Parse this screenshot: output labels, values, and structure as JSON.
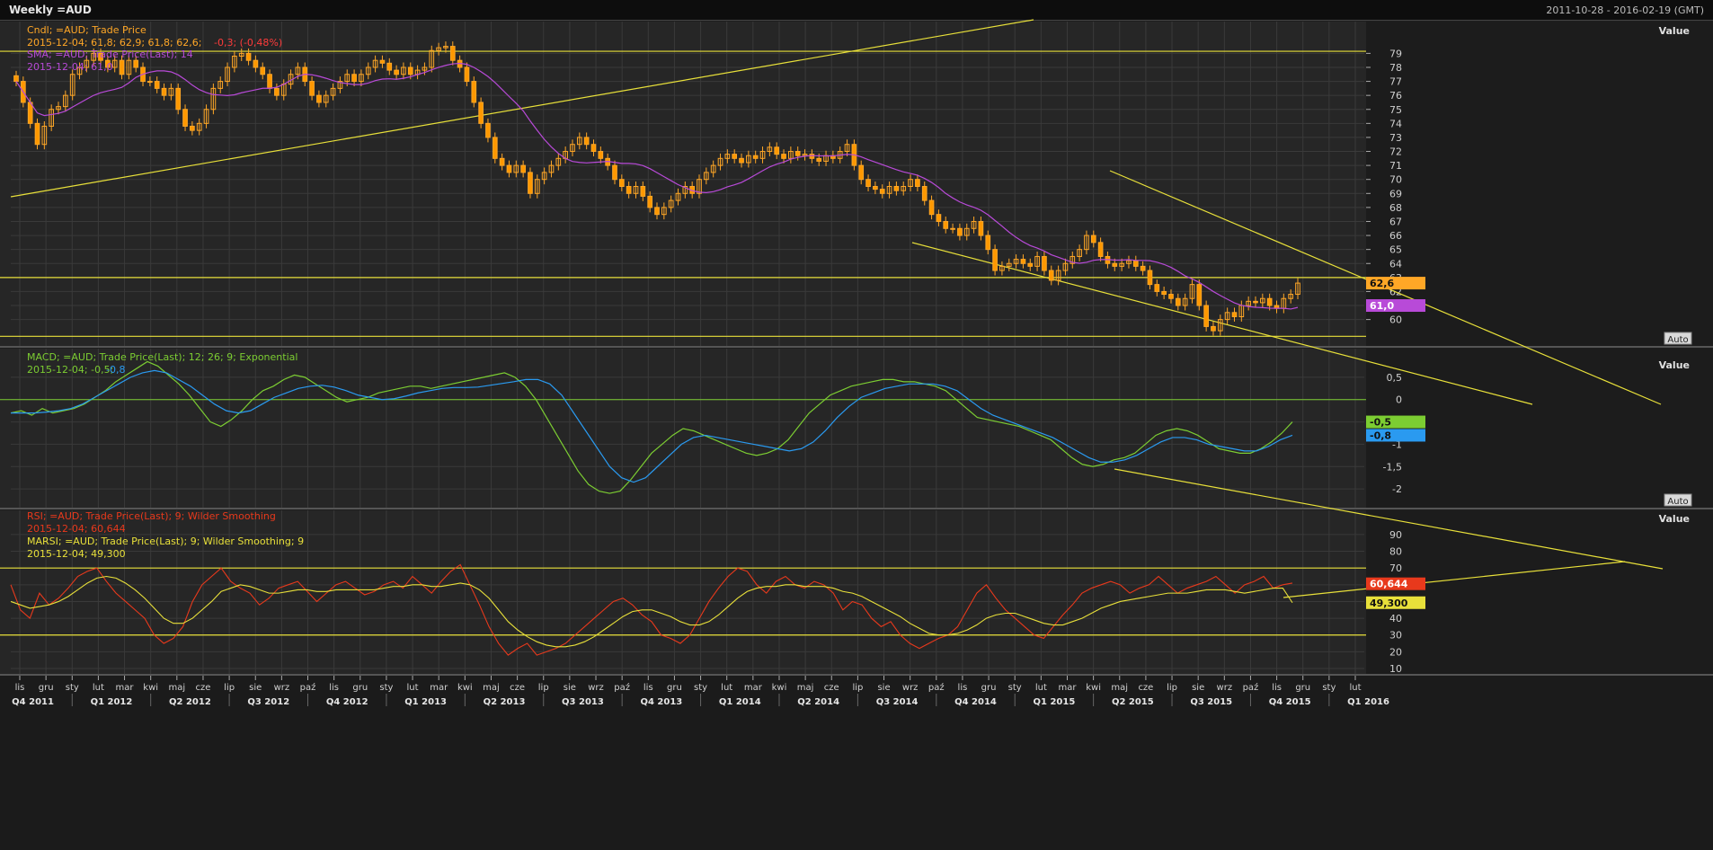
{
  "window": {
    "title": "Weekly =AUD",
    "date_range": "2011-10-28 - 2016-02-19 (GMT)"
  },
  "colors": {
    "background": "#262626",
    "grid": "#3a3a3a",
    "up_candle": "#ffa726",
    "down_candle": "#ff9800",
    "sma": "#b84ad8",
    "macd": "#7ccd32",
    "signal": "#2a9af0",
    "rsi": "#e8391c",
    "marsi": "#e8e03a",
    "trendline": "#e8e03a"
  },
  "axis": {
    "value_label": "Value",
    "auto_button": "Auto"
  },
  "chart_data": [
    {
      "type": "candlestick",
      "legend": [
        "Cndl; =AUD; Trade Price",
        "2015-12-04; 61,8; 62,9; 61,8; 62,6;",
        "-0,3; (-0,48%)",
        "SMA; =AUD; Trade Price(Last);  14",
        "2015-12-04; 61,0"
      ],
      "ylim": [
        58.5,
        80.5
      ],
      "yticks": [
        60,
        61,
        62,
        63,
        64,
        65,
        66,
        67,
        68,
        69,
        70,
        71,
        72,
        73,
        74,
        75,
        76,
        77,
        78,
        79
      ],
      "last_price_label": "62,6",
      "sma_label": "61,0",
      "close_approx": [
        77,
        75.5,
        74,
        72.5,
        73.8,
        75,
        75.2,
        76,
        77.5,
        78,
        78.5,
        79,
        78.5,
        78,
        78.5,
        77.5,
        78.5,
        78,
        77,
        77,
        76.5,
        76,
        76.5,
        75,
        73.8,
        73.5,
        74,
        75,
        76.5,
        77,
        78,
        78.8,
        79,
        78.5,
        78,
        77.5,
        76.5,
        76,
        76.8,
        77.5,
        78,
        77,
        76,
        75.5,
        76,
        76.5,
        77,
        77.5,
        77,
        77.5,
        78,
        78.5,
        78.3,
        77.8,
        77.5,
        78,
        77.5,
        77.8,
        78,
        79.2,
        79.4,
        79.5,
        78.5,
        78,
        77,
        75.5,
        74,
        73,
        71.5,
        71,
        70.5,
        71,
        70.5,
        69,
        70,
        70.5,
        71,
        71.5,
        72,
        72.5,
        73,
        72.5,
        72,
        71.5,
        71,
        70,
        69.5,
        69,
        69.5,
        68.8,
        68,
        67.5,
        68,
        68.5,
        69,
        69.5,
        69,
        70,
        70.5,
        71,
        71.5,
        71.8,
        71.5,
        71.2,
        71.7,
        71.5,
        72,
        72.3,
        71.8,
        71.5,
        72,
        71.7,
        71.8,
        71.5,
        71.3,
        71.7,
        71.5,
        72,
        72.5,
        71,
        70,
        69.5,
        69.3,
        69,
        69.5,
        69.2,
        69.5,
        70,
        69.5,
        68.5,
        67.5,
        67,
        66.5,
        66.5,
        66,
        66.5,
        67,
        66,
        65,
        63.5,
        63.8,
        64,
        64.3,
        64,
        63.8,
        64.5,
        63.5,
        62.8,
        63.5,
        64,
        64.5,
        65,
        66,
        65.5,
        64.5,
        64,
        63.8,
        64,
        64.2,
        63.8,
        63.5,
        62.5,
        62,
        61.8,
        61.5,
        61,
        61.5,
        62.5,
        61,
        59.5,
        59.2,
        60,
        60.5,
        60.2,
        61,
        61.3,
        61.2,
        61.5,
        61,
        60.8,
        61.5,
        61.8,
        62.6
      ]
    },
    {
      "type": "line",
      "legend": [
        "MACD; =AUD; Trade Price(Last);  12; 26; 9; Exponential",
        "2015-12-04; -0,5;",
        "-0,8"
      ],
      "ylim": [
        -2.3,
        0.9
      ],
      "yticks": [
        -2,
        -1.5,
        -1,
        -0.5,
        0,
        0.5
      ],
      "ytick_labels": [
        "-2",
        "-1,5",
        "-1",
        "-0,5",
        "0",
        "0,5"
      ],
      "series": [
        {
          "name": "MACD",
          "values": [
            -0.3,
            -0.25,
            -0.35,
            -0.2,
            -0.3,
            -0.25,
            -0.2,
            -0.1,
            0.05,
            0.2,
            0.4,
            0.55,
            0.7,
            0.85,
            0.75,
            0.55,
            0.35,
            0.1,
            -0.2,
            -0.5,
            -0.6,
            -0.45,
            -0.25,
            0,
            0.2,
            0.3,
            0.45,
            0.55,
            0.5,
            0.35,
            0.2,
            0.05,
            -0.05,
            0.0,
            0.05,
            0.15,
            0.2,
            0.25,
            0.3,
            0.3,
            0.25,
            0.3,
            0.35,
            0.4,
            0.45,
            0.5,
            0.55,
            0.6,
            0.5,
            0.3,
            0.0,
            -0.4,
            -0.8,
            -1.2,
            -1.6,
            -1.9,
            -2.05,
            -2.1,
            -2.05,
            -1.8,
            -1.5,
            -1.2,
            -1.0,
            -0.8,
            -0.65,
            -0.7,
            -0.8,
            -0.9,
            -1.0,
            -1.1,
            -1.2,
            -1.25,
            -1.2,
            -1.1,
            -0.9,
            -0.6,
            -0.3,
            -0.1,
            0.1,
            0.2,
            0.3,
            0.35,
            0.4,
            0.45,
            0.45,
            0.4,
            0.4,
            0.35,
            0.3,
            0.2,
            0.0,
            -0.2,
            -0.4,
            -0.45,
            -0.5,
            -0.55,
            -0.6,
            -0.7,
            -0.8,
            -0.9,
            -1.1,
            -1.3,
            -1.45,
            -1.5,
            -1.45,
            -1.35,
            -1.3,
            -1.2,
            -1.0,
            -0.8,
            -0.7,
            -0.65,
            -0.7,
            -0.8,
            -0.95,
            -1.1,
            -1.15,
            -1.2,
            -1.2,
            -1.1,
            -0.95,
            -0.75,
            -0.5
          ]
        },
        {
          "name": "Signal",
          "values": [
            -0.3,
            -0.3,
            -0.3,
            -0.28,
            -0.25,
            -0.2,
            -0.1,
            0.05,
            0.2,
            0.35,
            0.5,
            0.6,
            0.65,
            0.6,
            0.45,
            0.3,
            0.1,
            -0.1,
            -0.25,
            -0.3,
            -0.25,
            -0.1,
            0.05,
            0.15,
            0.25,
            0.3,
            0.32,
            0.28,
            0.2,
            0.1,
            0.05,
            0.0,
            0.02,
            0.08,
            0.15,
            0.2,
            0.25,
            0.27,
            0.27,
            0.28,
            0.32,
            0.36,
            0.4,
            0.45,
            0.45,
            0.35,
            0.1,
            -0.3,
            -0.7,
            -1.1,
            -1.5,
            -1.75,
            -1.85,
            -1.75,
            -1.5,
            -1.25,
            -1.0,
            -0.85,
            -0.8,
            -0.85,
            -0.9,
            -0.95,
            -1.0,
            -1.05,
            -1.1,
            -1.15,
            -1.1,
            -0.95,
            -0.7,
            -0.4,
            -0.15,
            0.05,
            0.15,
            0.25,
            0.3,
            0.35,
            0.35,
            0.35,
            0.3,
            0.2,
            0.0,
            -0.2,
            -0.35,
            -0.45,
            -0.55,
            -0.65,
            -0.75,
            -0.85,
            -1.0,
            -1.15,
            -1.3,
            -1.4,
            -1.4,
            -1.35,
            -1.25,
            -1.1,
            -0.95,
            -0.85,
            -0.85,
            -0.9,
            -1.0,
            -1.05,
            -1.1,
            -1.15,
            -1.15,
            -1.05,
            -0.9,
            -0.8
          ]
        }
      ]
    },
    {
      "type": "line",
      "legend": [
        "RSI; =AUD; Trade Price(Last);  9; Wilder Smoothing",
        "2015-12-04; 60,644",
        "MARSI; =AUD; Trade Price(Last);  9; Wilder Smoothing; 9",
        "2015-12-04; 49,300"
      ],
      "ylim": [
        10,
        98
      ],
      "yticks": [
        10,
        20,
        30,
        40,
        50,
        60,
        70,
        80,
        90
      ],
      "series": [
        {
          "name": "RSI",
          "values": [
            60,
            45,
            40,
            55,
            48,
            52,
            58,
            65,
            68,
            70,
            62,
            55,
            50,
            45,
            40,
            30,
            25,
            28,
            35,
            50,
            60,
            65,
            70,
            62,
            58,
            55,
            48,
            52,
            58,
            60,
            62,
            56,
            50,
            55,
            60,
            62,
            58,
            54,
            56,
            60,
            62,
            58,
            65,
            60,
            55,
            62,
            68,
            72,
            60,
            48,
            35,
            25,
            18,
            22,
            25,
            18,
            20,
            22,
            25,
            30,
            35,
            40,
            45,
            50,
            52,
            48,
            42,
            38,
            30,
            28,
            25,
            30,
            40,
            50,
            58,
            65,
            70,
            68,
            60,
            55,
            62,
            65,
            60,
            58,
            62,
            60,
            55,
            45,
            50,
            48,
            40,
            35,
            38,
            30,
            25,
            22,
            25,
            28,
            30,
            35,
            45,
            55,
            60,
            52,
            45,
            40,
            35,
            30,
            28,
            35,
            42,
            48,
            55,
            58,
            60,
            62,
            60,
            55,
            58,
            60,
            65,
            60,
            55,
            58,
            60,
            62,
            65,
            60,
            55,
            60,
            62,
            65,
            58,
            60,
            61
          ]
        },
        {
          "name": "MARSI",
          "values": [
            50,
            48,
            46,
            47,
            48,
            50,
            53,
            57,
            61,
            64,
            65,
            64,
            61,
            57,
            52,
            46,
            40,
            37,
            37,
            40,
            45,
            50,
            56,
            58,
            60,
            59,
            57,
            55,
            55,
            56,
            57,
            57,
            56,
            56,
            57,
            57,
            57,
            57,
            57,
            58,
            59,
            59,
            60,
            60,
            59,
            59,
            60,
            61,
            60,
            57,
            52,
            45,
            38,
            33,
            29,
            26,
            24,
            23,
            23,
            24,
            26,
            29,
            33,
            37,
            41,
            44,
            45,
            45,
            43,
            41,
            38,
            36,
            36,
            38,
            42,
            47,
            52,
            56,
            58,
            59,
            59,
            60,
            60,
            59,
            59,
            59,
            58,
            56,
            55,
            53,
            50,
            47,
            44,
            41,
            37,
            34,
            31,
            30,
            30,
            31,
            33,
            36,
            40,
            42,
            43,
            43,
            41,
            39,
            37,
            36,
            36,
            38,
            40,
            43,
            46,
            48,
            50,
            51,
            52,
            53,
            54,
            55,
            55,
            55,
            56,
            57,
            57,
            57,
            56,
            55,
            56,
            57,
            58,
            58,
            49.3
          ]
        }
      ],
      "last_rsi_label": "60,644",
      "last_marsi_label": "49,300"
    }
  ],
  "x_axis": {
    "months": [
      "lis",
      "gru",
      "sty",
      "lut",
      "mar",
      "kwi",
      "maj",
      "cze",
      "lip",
      "sie",
      "wrz",
      "paź",
      "lis",
      "gru",
      "sty",
      "lut",
      "mar",
      "kwi",
      "maj",
      "cze",
      "lip",
      "sie",
      "wrz",
      "paź",
      "lis",
      "gru",
      "sty",
      "lut",
      "mar",
      "kwi",
      "maj",
      "cze",
      "lip",
      "sie",
      "wrz",
      "paź",
      "lis",
      "gru",
      "sty",
      "lut",
      "mar",
      "kwi",
      "maj",
      "cze",
      "lip",
      "sie",
      "wrz",
      "paź",
      "lis",
      "gru",
      "sty",
      "lut"
    ],
    "quarters": [
      "Q4 2011",
      "Q1 2012",
      "Q2 2012",
      "Q3 2012",
      "Q4 2012",
      "Q1 2013",
      "Q2 2013",
      "Q3 2013",
      "Q4 2013",
      "Q1 2014",
      "Q2 2014",
      "Q3 2014",
      "Q4 2014",
      "Q1 2015",
      "Q2 2015",
      "Q3 2015",
      "Q4 2015",
      "Q1 2016"
    ]
  }
}
